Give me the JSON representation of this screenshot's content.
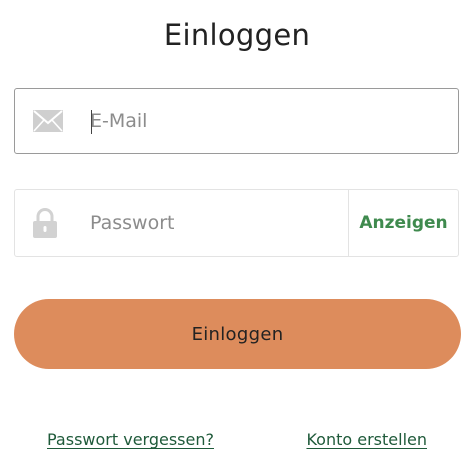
{
  "header": {
    "title": "Einloggen"
  },
  "email": {
    "value": "",
    "placeholder": "E-Mail",
    "icon": "envelope-icon"
  },
  "password": {
    "value": "",
    "placeholder": "Passwort",
    "icon": "lock-icon",
    "show_label": "Anzeigen"
  },
  "login_button": {
    "label": "Einloggen"
  },
  "links": {
    "forgot_password": "Passwort vergessen?",
    "create_account": "Konto erstellen"
  },
  "colors": {
    "accent_button": "#dd8c5c",
    "show_toggle": "#3f8a4e",
    "link": "#1f5a3a",
    "icon_gray": "#c9c9c9"
  }
}
